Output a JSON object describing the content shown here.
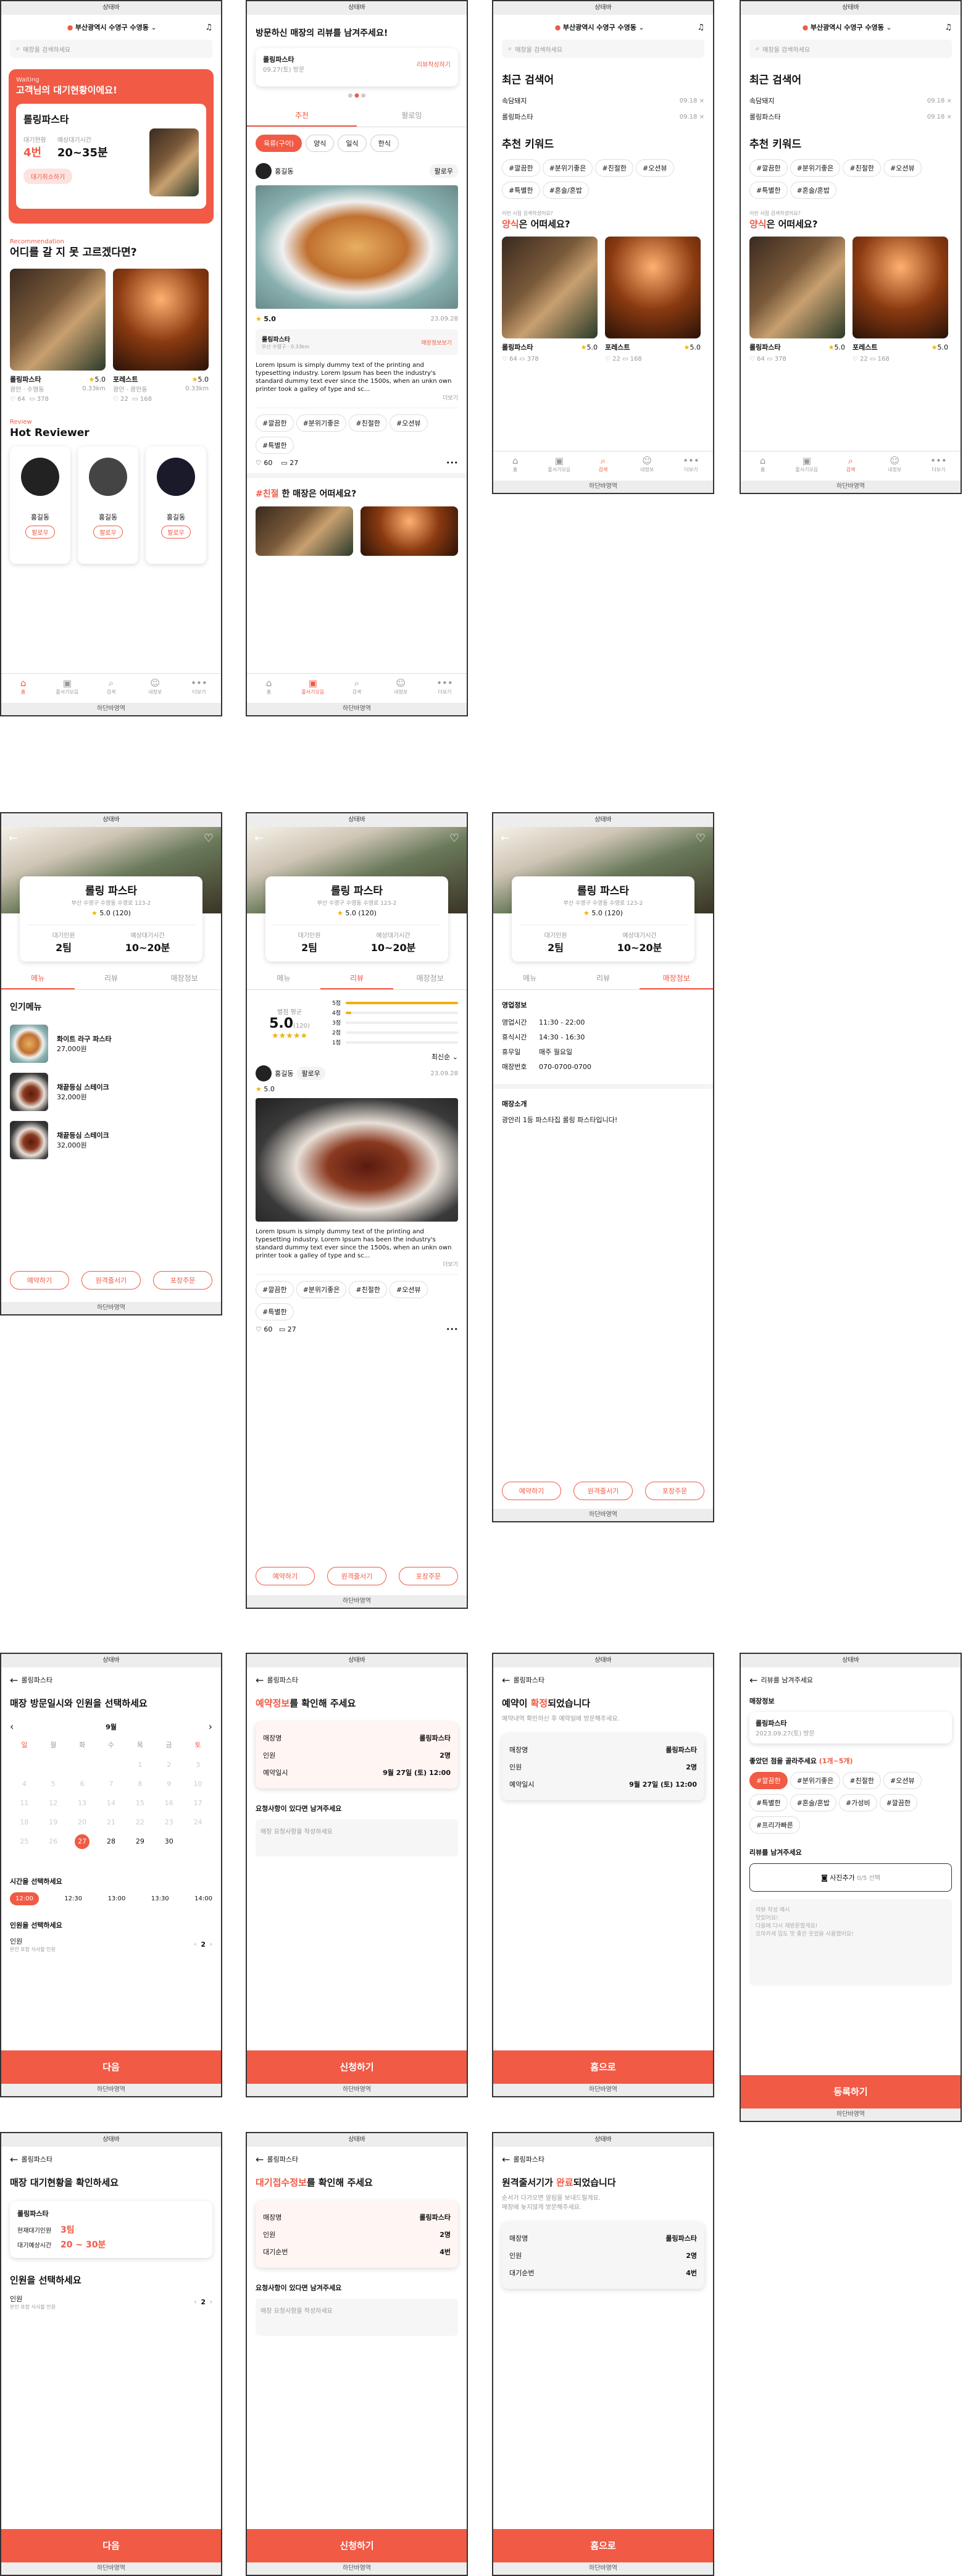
{
  "common": {
    "status": "상태바",
    "homebar": "하단바영역",
    "location": "부산광역시 수영구 수영동",
    "back": "←",
    "heart": "♡",
    "share": "⤤",
    "bell": "🔔"
  },
  "tabbar": [
    {
      "icon": "⌂",
      "label": "홈"
    },
    {
      "icon": "▣",
      "label": "줄서기모음"
    },
    {
      "icon": "⌕",
      "label": "검색"
    },
    {
      "icon": "☺",
      "label": "내정보"
    },
    {
      "icon": "•••",
      "label": "더보기"
    }
  ],
  "home": {
    "search_placeholder": "매장을 검색하세요",
    "waiting_tag": "Waiting",
    "waiting_title": "고객님의 대기현황이에요!",
    "store": "롤링파스타",
    "team_label": "대기현황",
    "team": "4번",
    "time_label": "예상대기시간",
    "time": "20~35분",
    "cancel": "대기취소하기",
    "reco_tag": "Recommendation",
    "reco_title": "어디를 갈 지 못 고르겠다면?",
    "review_tag": "Review",
    "review_title": "Hot Reviewer",
    "reviewers": [
      {
        "name": "홍길동",
        "btn": "팔로우"
      },
      {
        "name": "홍길동",
        "btn": "팔로우"
      },
      {
        "name": "홍길동",
        "btn": "팔로우"
      }
    ]
  },
  "restaurants": [
    {
      "name": "롤링파스타",
      "rating": "5.0",
      "desc": "광안 · 수영동",
      "dist": "0.33km",
      "likes": "64",
      "comments": "378"
    },
    {
      "name": "포레스트",
      "rating": "5.0",
      "desc": "광안 · 광안동",
      "dist": "0.33km",
      "likes": "22",
      "comments": "168"
    }
  ],
  "feed": {
    "banner_title": "방문하신 매장의 리뷰를 남겨주세요!",
    "banner_store": "롤링파스타",
    "banner_date": "09.27(토) 방문",
    "banner_link": "리뷰작성하기",
    "tabs": [
      "추천",
      "팔로잉"
    ],
    "chips": [
      "육류(구이)",
      "양식",
      "일식",
      "한식"
    ],
    "user": "홍길동",
    "follow": "팔로우",
    "rating": "5.0",
    "date": "23.09.28",
    "store": "롤링파스타",
    "store_sub": "부산 수영구 · 0.33km",
    "store_link": "매장정보보기",
    "body": "Lorem Ipsum is simply dummy text of the printing and typesetting industry. Lorem Ipsum has been the industry's standard dummy text ever since the 1500s, when an unkn own printer took a galley of type and sc...",
    "more": "더보기",
    "tags": [
      "#깔끔한",
      "#분위기좋은",
      "#친절한",
      "#오션뷰",
      "#특별한"
    ],
    "likes": "60",
    "comments": "27",
    "q_hash": "#친절",
    "q_rest": "한 매장은 어떠세요?"
  },
  "search": {
    "recent_title": "최근 검색어",
    "recent": [
      {
        "term": "속담돼지",
        "date": "09.18"
      },
      {
        "term": "롤링파스타",
        "date": "09.18"
      }
    ],
    "kw_title": "추천 키워드",
    "keywords": [
      "#깔끔한",
      "#분위기좋은",
      "#친절한",
      "#오션뷰",
      "#특별한",
      "#혼술/혼밥"
    ],
    "q_small": "이런 서점 검색하셨어요?",
    "q_hash": "양식",
    "q_rest": "은 어떠세요?"
  },
  "detail": {
    "name": "롤링 파스타",
    "addr": "부산 수영구 수영동 수영로 123-2",
    "rating": "5.0",
    "count": "(120)",
    "team_label": "대기인원",
    "team": "2팀",
    "time_label": "예상대기시간",
    "time": "10~20분",
    "tabs": [
      "메뉴",
      "리뷰",
      "매장정보"
    ],
    "menu_title": "인기메뉴",
    "menu": [
      {
        "name": "화이트 라구 파스타",
        "price": "27,000원"
      },
      {
        "name": "채끝등심 스테이크",
        "price": "32,000원"
      },
      {
        "name": "채끝등심 스테이크",
        "price": "32,000원"
      }
    ],
    "buttons": [
      "예약하기",
      "원격줄서기",
      "포장주문"
    ],
    "avg_label": "별점 평균",
    "avg": "5.0",
    "avg_count": "(120)",
    "bars": [
      {
        "label": "5점",
        "val": 1.0
      },
      {
        "label": "4점",
        "val": 0.05
      },
      {
        "label": "3점",
        "val": 0.0
      },
      {
        "label": "2점",
        "val": 0.0
      },
      {
        "label": "1점",
        "val": 0.0
      }
    ],
    "sort": "최신순",
    "info_title": "영업정보",
    "info": [
      {
        "k": "영업시간",
        "v": "11:30 - 22:00"
      },
      {
        "k": "휴식시간",
        "v": "14:30 - 16:30"
      },
      {
        "k": "휴무일",
        "v": "매주 월요일"
      },
      {
        "k": "매장번호",
        "v": "070-0700-0700"
      }
    ],
    "intro_title": "매장소개",
    "intro": "광안리 1등 파스타집 롤링 파스타입니다!"
  },
  "reserve": {
    "header": "롤링파스타",
    "title": "매장 방문일시와 인원을 선택하세요",
    "month": "9월",
    "dows": [
      "일",
      "월",
      "화",
      "수",
      "목",
      "금",
      "토"
    ],
    "days": [
      "",
      "",
      "",
      "",
      "1",
      "2",
      "3",
      "4",
      "5",
      "6",
      "7",
      "8",
      "9",
      "10",
      "11",
      "12",
      "13",
      "14",
      "15",
      "16",
      "17",
      "18",
      "19",
      "20",
      "21",
      "22",
      "23",
      "24",
      "25",
      "26",
      "27",
      "28",
      "29",
      "30",
      "",
      ""
    ],
    "sel_day": "27",
    "time_title": "시간을 선택하세요",
    "times": [
      "12:00",
      "12:30",
      "13:00",
      "13:30",
      "14:00"
    ],
    "people_title": "인원을 선택하세요",
    "people_label": "인원",
    "people_sub": "본인 포함 식사할 인원",
    "people": "2",
    "next": "다음"
  },
  "confirm": {
    "title_acc": "예약정보",
    "title_rest": "를 확인해 주세요",
    "rows": [
      {
        "k": "매장명",
        "v": "롤링파스타"
      },
      {
        "k": "인원",
        "v": "2명"
      },
      {
        "k": "예약일시",
        "v": "9월 27일 (토) 12:00"
      }
    ],
    "req_title": "요청사항이 있다면 남겨주세요",
    "req_ph": "매장 요청사항을 작성하세요",
    "apply": "신청하기"
  },
  "done": {
    "title_a": "예약이 ",
    "title_acc": "확정",
    "title_b": "되었습니다",
    "desc": "예약내역 확인하신 후 예약일에 방문해주세요.",
    "ok": "홈으로"
  },
  "review": {
    "header": "리뷰를 남겨주세요",
    "info_title": "매장정보",
    "store": "롤링파스타",
    "store_sub": "2023.09.27(토) 방문",
    "kw_title": "좋았던 점을 골라주세요",
    "kw_hint": "(1개~5개)",
    "keywords": [
      "#깔끔한",
      "#분위기좋은",
      "#친절한",
      "#오션뷰",
      "#특별한",
      "#혼술/혼밥",
      "#가성비",
      "#깔끔한",
      "#프리가빠른"
    ],
    "write_title": "리뷰를 남겨주세요",
    "photo_btn": "사진추가",
    "photo_count": "0/5 선택",
    "text_ph": "리뷰 작성 예시\n맛있어요!\n다음에 다시 재방문할게요!\n오마카세 입도 맛 좋은 웃었을 사용했어요!",
    "submit": "등록하기"
  },
  "queue": {
    "header": "롤링파스타",
    "title": "매장 대기현황을 확인하세요",
    "store": "롤링파스타",
    "team_label": "현재대기인원",
    "team": "3팀",
    "time_label": "대기예상시간",
    "time": "20 ~ 30분",
    "people_title": "인원을 선택하세요",
    "people_label": "인원",
    "people_sub": "본인 포함 식사할 인원",
    "people": "2",
    "next": "다음"
  },
  "qconfirm": {
    "title_acc": "대기접수정보",
    "title_rest": "를 확인해 주세요",
    "rows": [
      {
        "k": "매장명",
        "v": "롤링파스타"
      },
      {
        "k": "인원",
        "v": "2명"
      },
      {
        "k": "대기순번",
        "v": "4번"
      }
    ],
    "req_title": "요청사항이 있다면 남겨주세요",
    "req_ph": "매장 요청사항을 작성하세요",
    "apply": "신청하기"
  },
  "qdone": {
    "title_a": "원격줄서기가 ",
    "title_acc": "완료",
    "title_b": "되었습니다",
    "desc": "순서가 다가오면 알림을 보내드릴게요.\n매장에 늦지않게 방문해주세요.",
    "rows": [
      {
        "k": "매장명",
        "v": "롤링파스타"
      },
      {
        "k": "인원",
        "v": "2명"
      },
      {
        "k": "대기순번",
        "v": "4번"
      }
    ],
    "ok": "홈으로"
  }
}
